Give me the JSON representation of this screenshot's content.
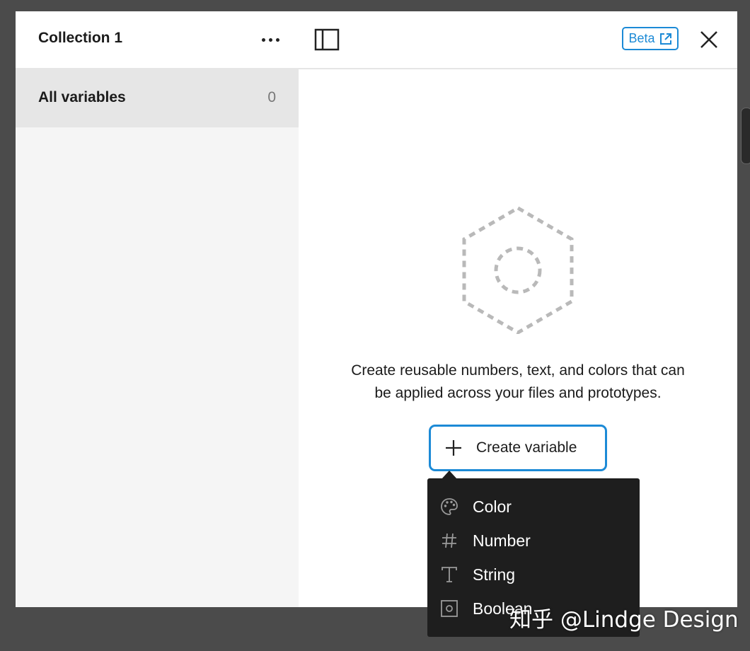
{
  "sidebar": {
    "collection_title": "Collection 1",
    "all_variables_label": "All variables",
    "all_variables_count": "0"
  },
  "header": {
    "beta_label": "Beta"
  },
  "empty_state": {
    "line1": "Create reusable numbers, text, and colors that can",
    "line2": "be applied across your files and prototypes.",
    "create_button_label": "Create variable"
  },
  "menu": {
    "items": [
      {
        "label": "Color",
        "icon": "palette-icon"
      },
      {
        "label": "Number",
        "icon": "hash-icon"
      },
      {
        "label": "String",
        "icon": "text-icon"
      },
      {
        "label": "Boolean",
        "icon": "boolean-icon"
      }
    ]
  },
  "watermark": "知乎 @Lindge Design",
  "colors": {
    "accent": "#1c8ad6",
    "menu_bg": "#1e1e1e",
    "sidebar_bg": "#f5f5f5",
    "selected_bg": "#e6e6e6"
  }
}
